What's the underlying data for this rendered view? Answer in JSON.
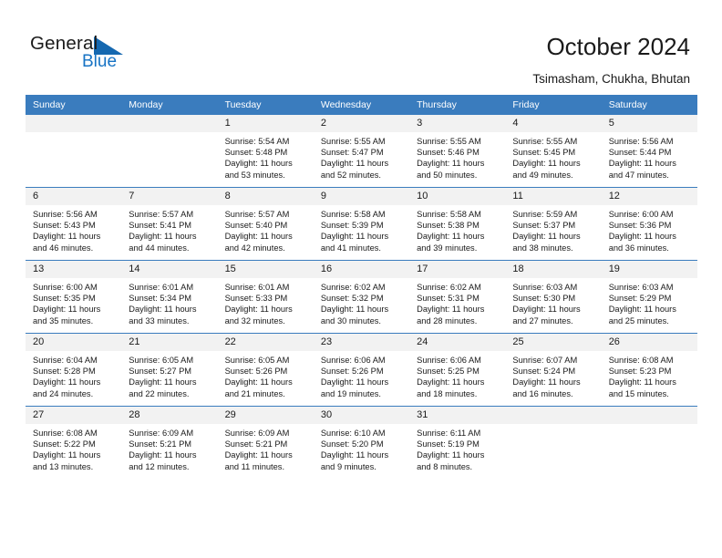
{
  "brand": {
    "name_top": "General",
    "name_bottom": "Blue",
    "accent_color": "#1773c4",
    "triangle_color": "#1568b0"
  },
  "header": {
    "title": "October 2024",
    "subtitle": "Tsimasham, Chukha, Bhutan"
  },
  "calendar": {
    "header_color": "#3a7cbe",
    "daynum_band_color": "#f2f2f2",
    "weekdays": [
      "Sunday",
      "Monday",
      "Tuesday",
      "Wednesday",
      "Thursday",
      "Friday",
      "Saturday"
    ],
    "labels": {
      "sunrise_prefix": "Sunrise: ",
      "sunset_prefix": "Sunset: ",
      "daylight_prefix": "Daylight: "
    },
    "weeks": [
      [
        {
          "day": "",
          "blank": true
        },
        {
          "day": "",
          "blank": true
        },
        {
          "day": "1",
          "sunrise": "Sunrise: 5:54 AM",
          "sunset": "Sunset: 5:48 PM",
          "daylight1": "Daylight: 11 hours",
          "daylight2": "and 53 minutes."
        },
        {
          "day": "2",
          "sunrise": "Sunrise: 5:55 AM",
          "sunset": "Sunset: 5:47 PM",
          "daylight1": "Daylight: 11 hours",
          "daylight2": "and 52 minutes."
        },
        {
          "day": "3",
          "sunrise": "Sunrise: 5:55 AM",
          "sunset": "Sunset: 5:46 PM",
          "daylight1": "Daylight: 11 hours",
          "daylight2": "and 50 minutes."
        },
        {
          "day": "4",
          "sunrise": "Sunrise: 5:55 AM",
          "sunset": "Sunset: 5:45 PM",
          "daylight1": "Daylight: 11 hours",
          "daylight2": "and 49 minutes."
        },
        {
          "day": "5",
          "sunrise": "Sunrise: 5:56 AM",
          "sunset": "Sunset: 5:44 PM",
          "daylight1": "Daylight: 11 hours",
          "daylight2": "and 47 minutes."
        }
      ],
      [
        {
          "day": "6",
          "sunrise": "Sunrise: 5:56 AM",
          "sunset": "Sunset: 5:43 PM",
          "daylight1": "Daylight: 11 hours",
          "daylight2": "and 46 minutes."
        },
        {
          "day": "7",
          "sunrise": "Sunrise: 5:57 AM",
          "sunset": "Sunset: 5:41 PM",
          "daylight1": "Daylight: 11 hours",
          "daylight2": "and 44 minutes."
        },
        {
          "day": "8",
          "sunrise": "Sunrise: 5:57 AM",
          "sunset": "Sunset: 5:40 PM",
          "daylight1": "Daylight: 11 hours",
          "daylight2": "and 42 minutes."
        },
        {
          "day": "9",
          "sunrise": "Sunrise: 5:58 AM",
          "sunset": "Sunset: 5:39 PM",
          "daylight1": "Daylight: 11 hours",
          "daylight2": "and 41 minutes."
        },
        {
          "day": "10",
          "sunrise": "Sunrise: 5:58 AM",
          "sunset": "Sunset: 5:38 PM",
          "daylight1": "Daylight: 11 hours",
          "daylight2": "and 39 minutes."
        },
        {
          "day": "11",
          "sunrise": "Sunrise: 5:59 AM",
          "sunset": "Sunset: 5:37 PM",
          "daylight1": "Daylight: 11 hours",
          "daylight2": "and 38 minutes."
        },
        {
          "day": "12",
          "sunrise": "Sunrise: 6:00 AM",
          "sunset": "Sunset: 5:36 PM",
          "daylight1": "Daylight: 11 hours",
          "daylight2": "and 36 minutes."
        }
      ],
      [
        {
          "day": "13",
          "sunrise": "Sunrise: 6:00 AM",
          "sunset": "Sunset: 5:35 PM",
          "daylight1": "Daylight: 11 hours",
          "daylight2": "and 35 minutes."
        },
        {
          "day": "14",
          "sunrise": "Sunrise: 6:01 AM",
          "sunset": "Sunset: 5:34 PM",
          "daylight1": "Daylight: 11 hours",
          "daylight2": "and 33 minutes."
        },
        {
          "day": "15",
          "sunrise": "Sunrise: 6:01 AM",
          "sunset": "Sunset: 5:33 PM",
          "daylight1": "Daylight: 11 hours",
          "daylight2": "and 32 minutes."
        },
        {
          "day": "16",
          "sunrise": "Sunrise: 6:02 AM",
          "sunset": "Sunset: 5:32 PM",
          "daylight1": "Daylight: 11 hours",
          "daylight2": "and 30 minutes."
        },
        {
          "day": "17",
          "sunrise": "Sunrise: 6:02 AM",
          "sunset": "Sunset: 5:31 PM",
          "daylight1": "Daylight: 11 hours",
          "daylight2": "and 28 minutes."
        },
        {
          "day": "18",
          "sunrise": "Sunrise: 6:03 AM",
          "sunset": "Sunset: 5:30 PM",
          "daylight1": "Daylight: 11 hours",
          "daylight2": "and 27 minutes."
        },
        {
          "day": "19",
          "sunrise": "Sunrise: 6:03 AM",
          "sunset": "Sunset: 5:29 PM",
          "daylight1": "Daylight: 11 hours",
          "daylight2": "and 25 minutes."
        }
      ],
      [
        {
          "day": "20",
          "sunrise": "Sunrise: 6:04 AM",
          "sunset": "Sunset: 5:28 PM",
          "daylight1": "Daylight: 11 hours",
          "daylight2": "and 24 minutes."
        },
        {
          "day": "21",
          "sunrise": "Sunrise: 6:05 AM",
          "sunset": "Sunset: 5:27 PM",
          "daylight1": "Daylight: 11 hours",
          "daylight2": "and 22 minutes."
        },
        {
          "day": "22",
          "sunrise": "Sunrise: 6:05 AM",
          "sunset": "Sunset: 5:26 PM",
          "daylight1": "Daylight: 11 hours",
          "daylight2": "and 21 minutes."
        },
        {
          "day": "23",
          "sunrise": "Sunrise: 6:06 AM",
          "sunset": "Sunset: 5:26 PM",
          "daylight1": "Daylight: 11 hours",
          "daylight2": "and 19 minutes."
        },
        {
          "day": "24",
          "sunrise": "Sunrise: 6:06 AM",
          "sunset": "Sunset: 5:25 PM",
          "daylight1": "Daylight: 11 hours",
          "daylight2": "and 18 minutes."
        },
        {
          "day": "25",
          "sunrise": "Sunrise: 6:07 AM",
          "sunset": "Sunset: 5:24 PM",
          "daylight1": "Daylight: 11 hours",
          "daylight2": "and 16 minutes."
        },
        {
          "day": "26",
          "sunrise": "Sunrise: 6:08 AM",
          "sunset": "Sunset: 5:23 PM",
          "daylight1": "Daylight: 11 hours",
          "daylight2": "and 15 minutes."
        }
      ],
      [
        {
          "day": "27",
          "sunrise": "Sunrise: 6:08 AM",
          "sunset": "Sunset: 5:22 PM",
          "daylight1": "Daylight: 11 hours",
          "daylight2": "and 13 minutes."
        },
        {
          "day": "28",
          "sunrise": "Sunrise: 6:09 AM",
          "sunset": "Sunset: 5:21 PM",
          "daylight1": "Daylight: 11 hours",
          "daylight2": "and 12 minutes."
        },
        {
          "day": "29",
          "sunrise": "Sunrise: 6:09 AM",
          "sunset": "Sunset: 5:21 PM",
          "daylight1": "Daylight: 11 hours",
          "daylight2": "and 11 minutes."
        },
        {
          "day": "30",
          "sunrise": "Sunrise: 6:10 AM",
          "sunset": "Sunset: 5:20 PM",
          "daylight1": "Daylight: 11 hours",
          "daylight2": "and 9 minutes."
        },
        {
          "day": "31",
          "sunrise": "Sunrise: 6:11 AM",
          "sunset": "Sunset: 5:19 PM",
          "daylight1": "Daylight: 11 hours",
          "daylight2": "and 8 minutes."
        },
        {
          "day": "",
          "blank": true
        },
        {
          "day": "",
          "blank": true
        }
      ]
    ]
  }
}
